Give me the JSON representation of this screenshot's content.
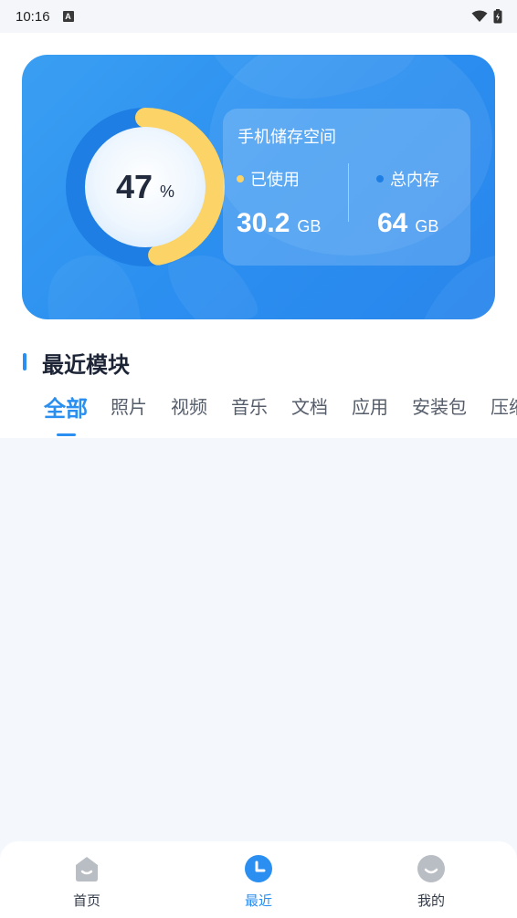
{
  "status_bar": {
    "time": "10:16",
    "a_icon": "A"
  },
  "storage": {
    "percent": "47",
    "percent_unit": "%",
    "used_fraction": 0.47,
    "title": "手机储存空间",
    "used_label": "已使用",
    "used_value": "30.2",
    "used_unit": "GB",
    "total_label": "总内存",
    "total_value": "64",
    "total_unit": "GB",
    "colors": {
      "card": "#2b8ff0",
      "ring_progress": "#fbd366",
      "ring_track": "#1e7ee4"
    }
  },
  "section": {
    "title": "最近模块"
  },
  "tabs": [
    {
      "label": "全部",
      "active": true
    },
    {
      "label": "照片",
      "active": false
    },
    {
      "label": "视频",
      "active": false
    },
    {
      "label": "音乐",
      "active": false
    },
    {
      "label": "文档",
      "active": false
    },
    {
      "label": "应用",
      "active": false
    },
    {
      "label": "安装包",
      "active": false
    },
    {
      "label": "压缩",
      "active": false
    }
  ],
  "bottom_nav": [
    {
      "label": "首页",
      "icon": "home-icon",
      "active": false
    },
    {
      "label": "最近",
      "icon": "clock-icon",
      "active": true
    },
    {
      "label": "我的",
      "icon": "profile-icon",
      "active": false
    }
  ],
  "accent_color": "#2a8ff0"
}
